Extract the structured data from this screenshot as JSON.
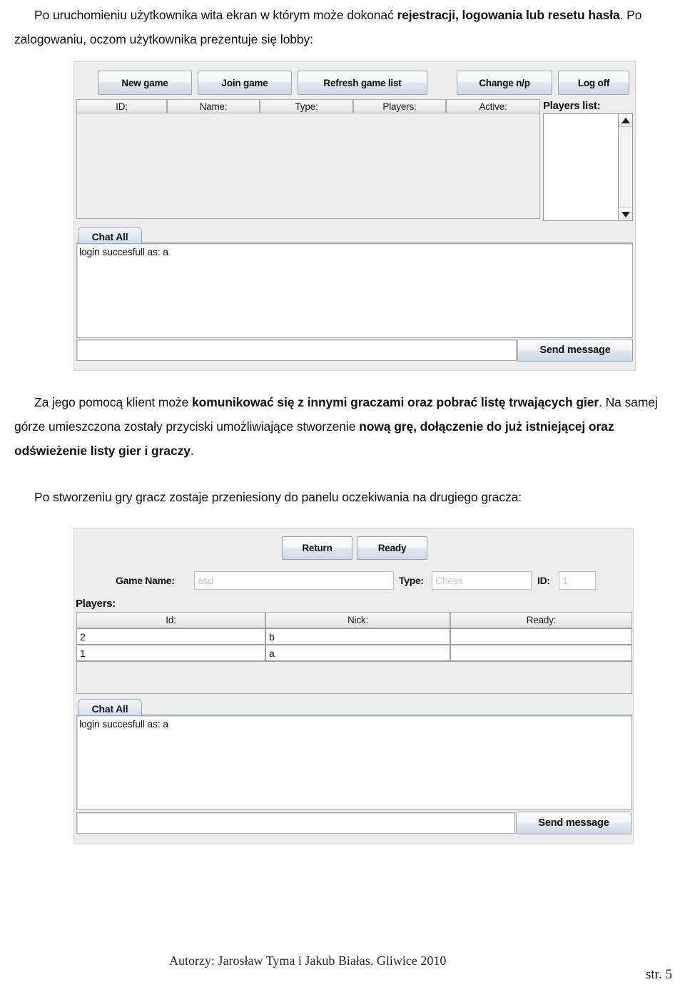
{
  "document": {
    "paragraph_1": {
      "part_1": "Po uruchomieniu użytkownika wita ekran w którym może dokonać ",
      "bold_1": "rejestracji, logowania lub resetu hasła",
      "part_2": ". Po zalogowaniu, oczom użytkownika prezentuje się lobby:"
    },
    "paragraph_2": {
      "part_1": "Za jego pomocą klient może ",
      "bold_1": "komunikować się z innymi graczami oraz pobrać listę trwających gier",
      "part_2": ". Na samej górze umieszczona zostały przyciski umożliwiające stworzenie ",
      "bold_2": "nową grę, dołączenie do już istniejącej oraz odświeżenie listy gier i graczy",
      "part_3": "."
    },
    "paragraph_3": "Po stworzeniu gry gracz zostaje przeniesiony do panelu oczekiwania na drugiego gracza:",
    "footer": {
      "authors": "Autorzy: Jarosław Tyma i Jakub Białas. Gliwice 2010",
      "page": "str. 5"
    }
  },
  "lobby": {
    "toolbar": {
      "new_game": "New game",
      "join_game": "Join game",
      "refresh_game_list": "Refresh game list",
      "change_np": "Change n/p",
      "log_off": "Log off"
    },
    "games_table": {
      "columns": [
        "ID:",
        "Name:",
        "Type:",
        "Players:",
        "Active:"
      ],
      "rows": []
    },
    "players_list": {
      "label": "Players list:",
      "items": []
    },
    "chat": {
      "tab_label": "Chat All",
      "messages": [
        "login succesfull as: a"
      ],
      "input_value": "",
      "send_label": "Send message"
    }
  },
  "game_waiting": {
    "buttons": {
      "return": "Return",
      "ready": "Ready"
    },
    "fields": {
      "game_name_label": "Game Name:",
      "game_name_value": "asd",
      "type_label": "Type:",
      "type_value": "Chess",
      "id_label": "ID:",
      "id_value": "1"
    },
    "players": {
      "label": "Players:",
      "columns": [
        "Id:",
        "Nick:",
        "Ready:"
      ],
      "rows": [
        {
          "id": "2",
          "nick": "b",
          "ready": ""
        },
        {
          "id": "1",
          "nick": "a",
          "ready": ""
        }
      ]
    },
    "chat": {
      "tab_label": "Chat All",
      "messages": [
        "login succesfull as: a"
      ],
      "input_value": "",
      "send_label": "Send message"
    }
  },
  "colors": {
    "panel_bg": "#ececed",
    "button_border": "#9aa4b4",
    "tab_active": "#dfe8f4"
  }
}
